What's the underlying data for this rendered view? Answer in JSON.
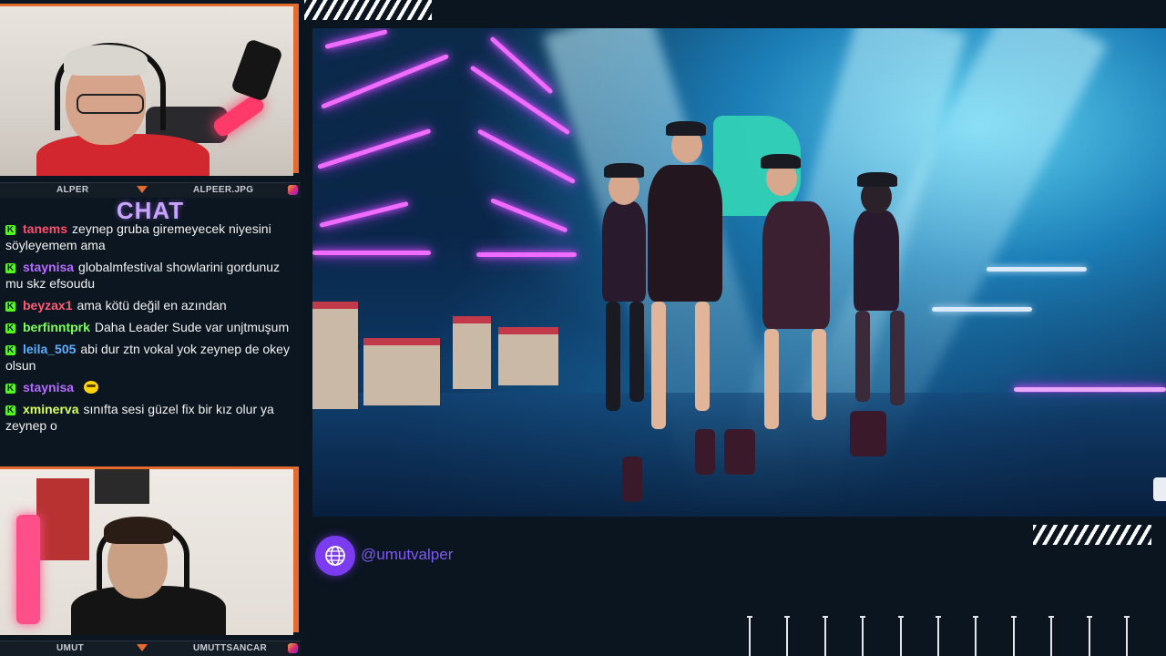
{
  "streamer_cam": {
    "name_left": "ALPER",
    "name_right": "ALPEER.JPG"
  },
  "guest_cam": {
    "name_left": "UMUT",
    "name_right": "UMUTTSANCAR"
  },
  "chat": {
    "title": "CHAT",
    "badge_letter": "K",
    "messages": [
      {
        "user": "tanems",
        "user_color": "#ff4d6d",
        "text": "zeynep gruba giremeyecek niyesini söyleyemem ama"
      },
      {
        "user": "staynisa",
        "user_color": "#b56cff",
        "text": "globalmfestival showlarini gordunuz mu skz efsoudu"
      },
      {
        "user": "beyzax1",
        "user_color": "#ff5c7a",
        "text": "ama kötü değil en azından"
      },
      {
        "user": "berfinntprk",
        "user_color": "#7dff5a",
        "text": "Daha Leader Sude var unjtmuşum"
      },
      {
        "user": "leila_505",
        "user_color": "#5ab0ff",
        "text": "abi dur ztn vokal yok zeynep de okey olsun"
      },
      {
        "user": "staynisa",
        "user_color": "#b56cff",
        "text": "",
        "emote": "emote-icon"
      },
      {
        "user": "xminerva",
        "user_color": "#d9ff5a",
        "text": "sınıfta sesi güzel fix bir kız olur ya zeynep o"
      }
    ]
  },
  "social": {
    "icon": "globe-icon",
    "handle": "@umutvalper"
  },
  "colors": {
    "accent_orange": "#e46a2e",
    "accent_purple": "#7b3cf0",
    "kick_green": "#53fc18"
  }
}
